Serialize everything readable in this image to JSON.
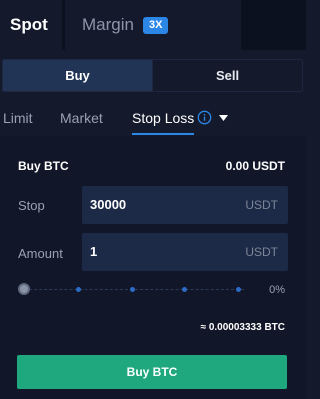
{
  "tabs": {
    "spot": "Spot",
    "margin": "Margin",
    "leverage": "3X"
  },
  "side": {
    "buy": "Buy",
    "sell": "Sell",
    "selected": "Buy"
  },
  "order_types": {
    "limit": "Limit",
    "market": "Market",
    "stop_loss": "Stop Loss",
    "selected": "Stop Loss"
  },
  "form": {
    "title": "Buy BTC",
    "balance": "0.00 USDT",
    "stop": {
      "label": "Stop",
      "value": "30000",
      "unit": "USDT"
    },
    "amount": {
      "label": "Amount",
      "value": "1",
      "unit": "USDT"
    },
    "slider": {
      "percent_label": "0%",
      "value_fraction": 0
    },
    "estimate": "≈ 0.00003333 BTC",
    "submit": "Buy BTC"
  },
  "colors": {
    "background": "#141a2b",
    "panel": "#111728",
    "accent": "#2b86e6",
    "buy_button": "#1fa87d",
    "input_bg": "#1c2a47"
  },
  "icons": {
    "info": "info-circle-icon",
    "caret": "caret-down-icon"
  }
}
